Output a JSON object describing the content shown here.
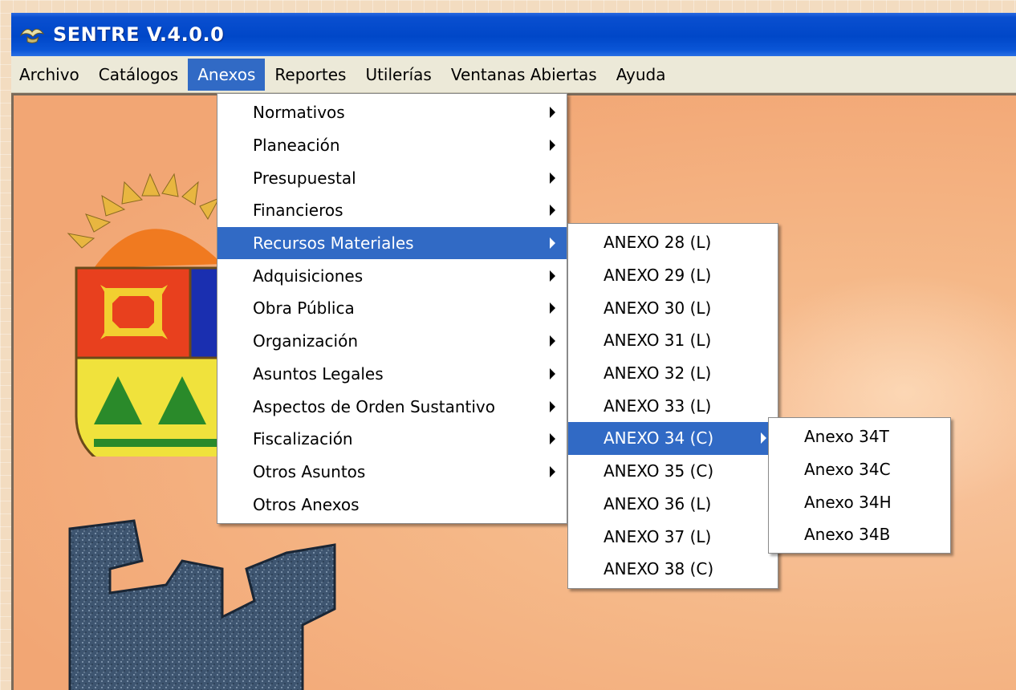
{
  "window": {
    "title": "SENTRE  V.4.0.0",
    "app_icon": "bird-icon"
  },
  "menubar": {
    "items": [
      "Archivo",
      "Catálogos",
      "Anexos",
      "Reportes",
      "Utilerías",
      "Ventanas Abiertas",
      "Ayuda"
    ],
    "active": "Anexos"
  },
  "anexos_menu": {
    "items": [
      {
        "label": "Normativos",
        "submenu": true
      },
      {
        "label": "Planeación",
        "submenu": true
      },
      {
        "label": "Presupuestal",
        "submenu": true
      },
      {
        "label": "Financieros",
        "submenu": true
      },
      {
        "label": "Recursos Materiales",
        "submenu": true,
        "highlighted": true
      },
      {
        "label": "Adquisiciones",
        "submenu": true
      },
      {
        "label": "Obra Pública",
        "submenu": true
      },
      {
        "label": "Organización",
        "submenu": true
      },
      {
        "label": "Asuntos Legales",
        "submenu": true
      },
      {
        "label": "Aspectos de Orden Sustantivo",
        "submenu": true
      },
      {
        "label": "Fiscalización",
        "submenu": true
      },
      {
        "label": "Otros Asuntos",
        "submenu": true
      },
      {
        "label": "Otros Anexos",
        "submenu": false
      }
    ]
  },
  "recursos_materiales_menu": {
    "items": [
      {
        "label": "ANEXO 28 (L)"
      },
      {
        "label": "ANEXO 29 (L)"
      },
      {
        "label": "ANEXO 30 (L)"
      },
      {
        "label": "ANEXO 31 (L)"
      },
      {
        "label": "ANEXO 32 (L)"
      },
      {
        "label": "ANEXO 33 (L)"
      },
      {
        "label": "ANEXO 34 (C)",
        "submenu": true,
        "highlighted": true
      },
      {
        "label": "ANEXO 35 (C)"
      },
      {
        "label": "ANEXO 36 (L)"
      },
      {
        "label": "ANEXO 37 (L)"
      },
      {
        "label": "ANEXO 38 (C)"
      }
    ]
  },
  "anexo34_menu": {
    "items": [
      {
        "label": "Anexo 34T"
      },
      {
        "label": "Anexo 34C"
      },
      {
        "label": "Anexo 34H"
      },
      {
        "label": "Anexo 34B"
      }
    ]
  },
  "colors": {
    "titlebar": "#0047c8",
    "menubar": "#ece9d8",
    "highlight": "#316ac5",
    "workspace": "#f5b888"
  }
}
